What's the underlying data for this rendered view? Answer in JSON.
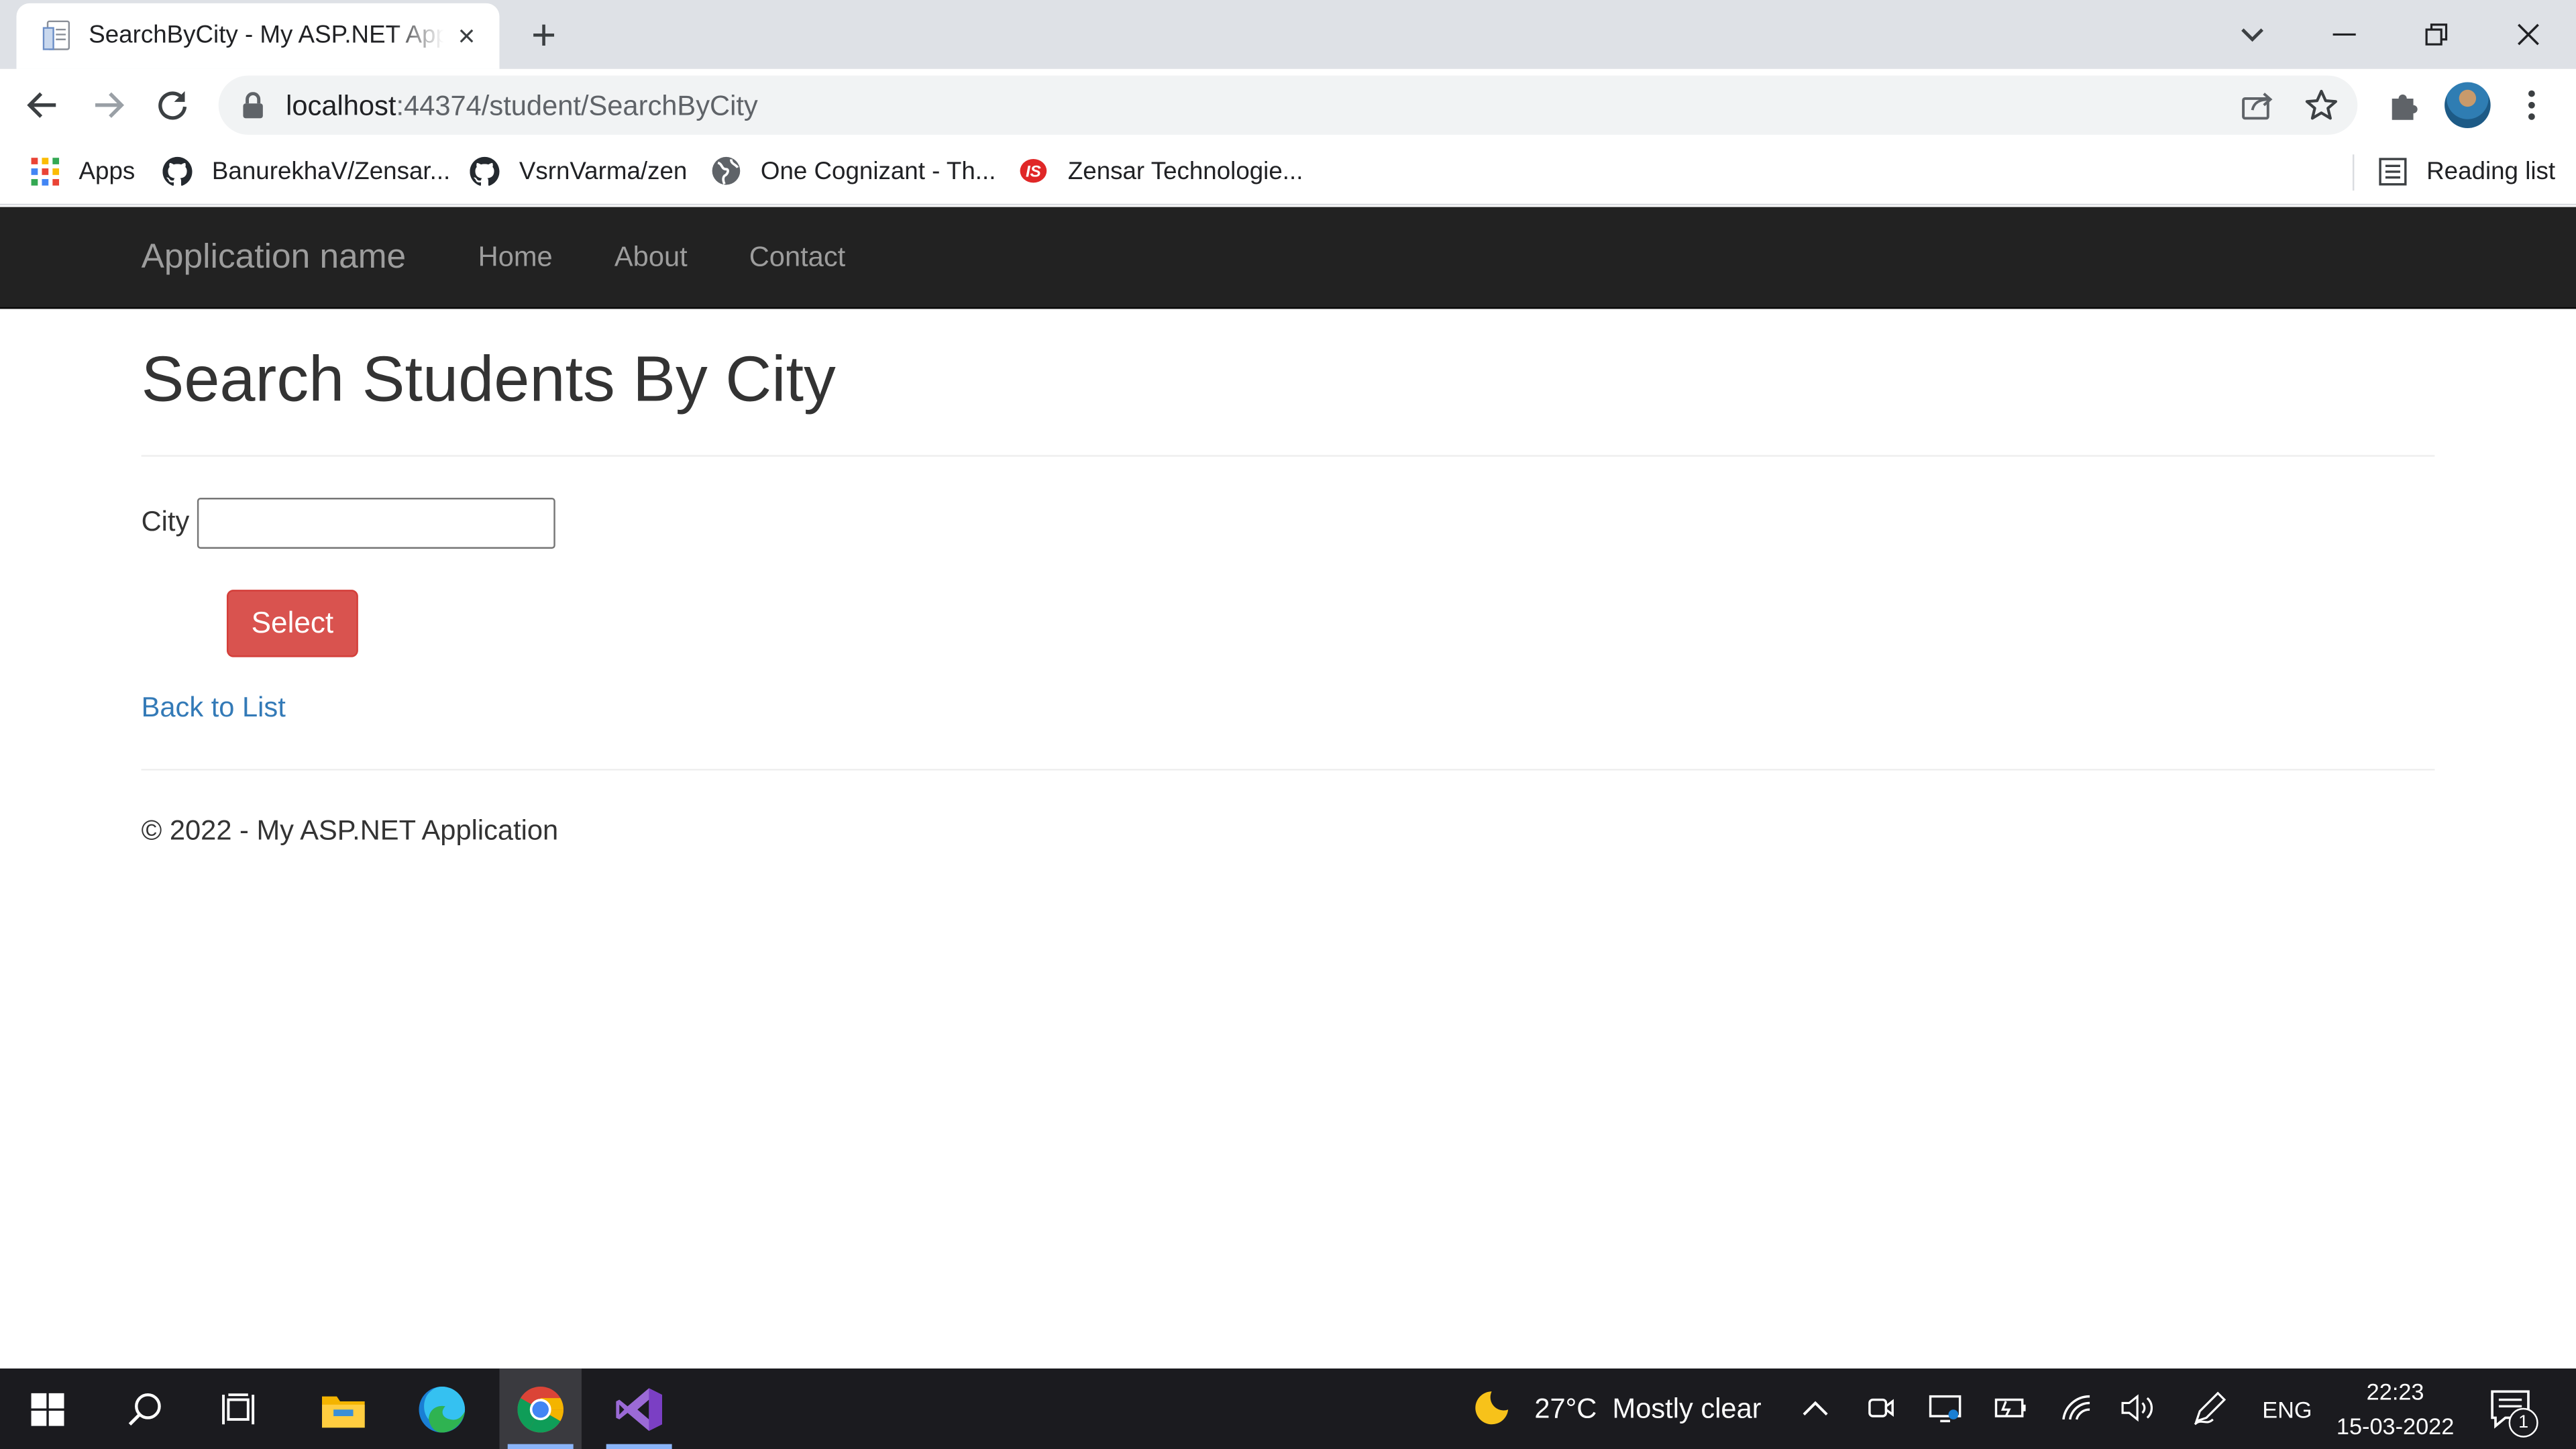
{
  "browser": {
    "tab": {
      "title": "SearchByCity - My ASP.NET Application",
      "close_label": "×"
    },
    "new_tab_label": "+",
    "address": {
      "host": "localhost",
      "path": ":44374/student/SearchByCity"
    },
    "bookmarks": [
      {
        "label": "Apps",
        "icon": "apps-grid-icon"
      },
      {
        "label": "BanurekhaV/Zensar...",
        "icon": "github-icon"
      },
      {
        "label": "VsrnVarma/zen",
        "icon": "github-icon"
      },
      {
        "label": "One Cognizant - Th...",
        "icon": "globe-icon"
      },
      {
        "label": "Zensar Technologie...",
        "icon": "zensar-logo-icon"
      }
    ],
    "reading_list_label": "Reading list"
  },
  "site": {
    "brand": "Application name",
    "nav": [
      "Home",
      "About",
      "Contact"
    ],
    "page_title": "Search Students By City",
    "form": {
      "city_label": "City",
      "city_value": "",
      "submit_label": "Select"
    },
    "back_link": "Back to List",
    "footer": "© 2022 - My ASP.NET Application"
  },
  "taskbar": {
    "weather": {
      "temp": "27°C",
      "condition": "Mostly clear"
    },
    "language": "ENG",
    "time": "22:23",
    "date": "15-03-2022",
    "notification_count": "1"
  },
  "colors": {
    "navbar_bg": "#222222",
    "navbar_text": "#9d9d9d",
    "button_danger": "#d9534f",
    "link": "#337ab7",
    "taskbar_bg": "#1b1b1f"
  }
}
